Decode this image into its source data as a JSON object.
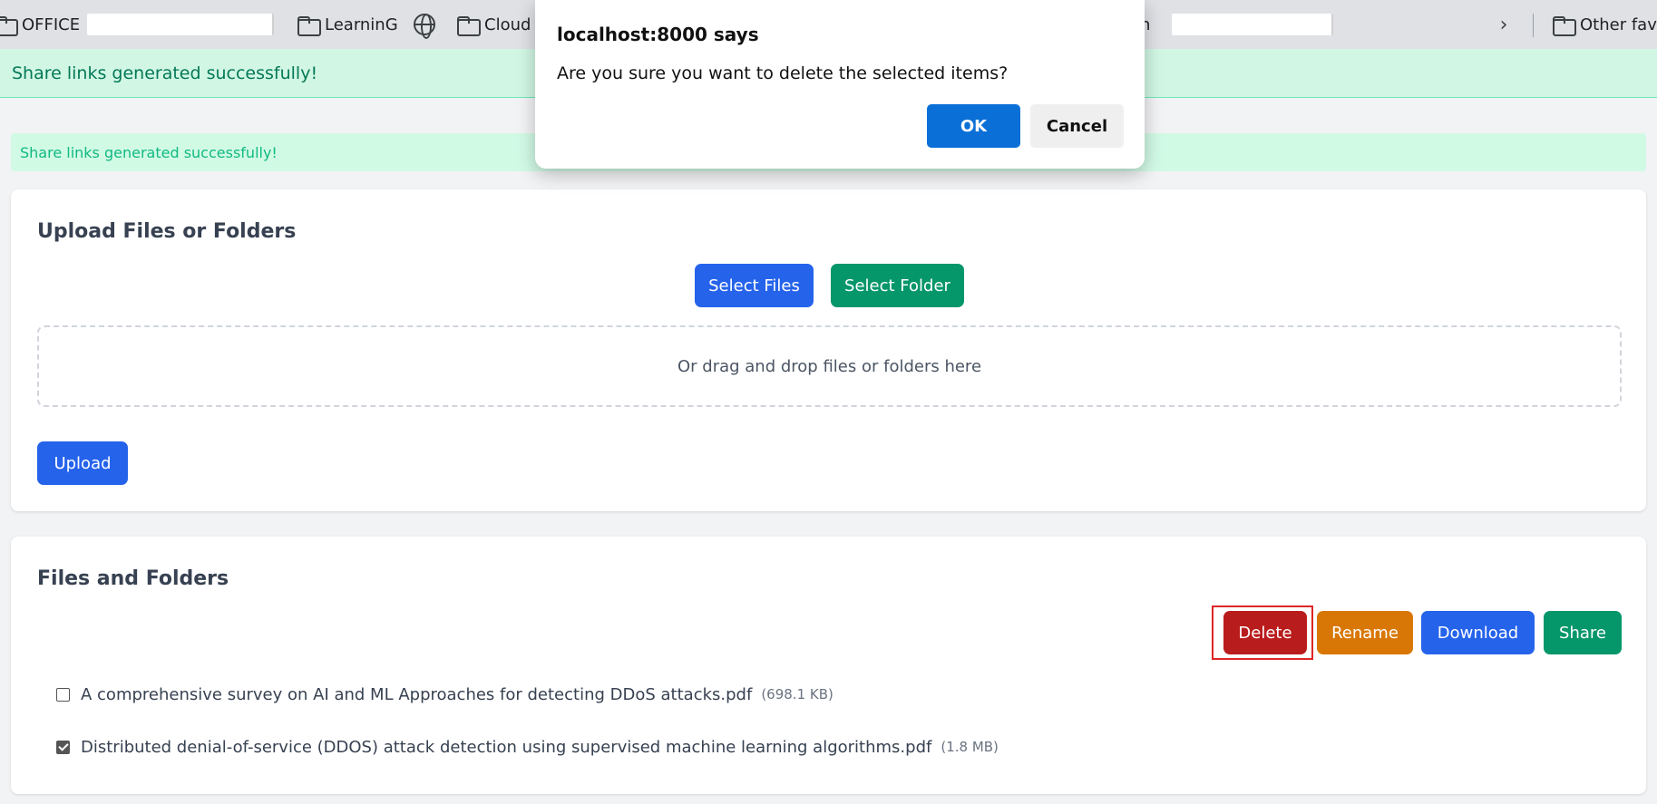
{
  "bookmarks": {
    "items": [
      {
        "label": "OFFICE",
        "icon": "folder-icon"
      },
      {
        "label": "",
        "icon": "blank"
      },
      {
        "label": "LearninG",
        "icon": "folder-icon"
      },
      {
        "label": "",
        "icon": "globe-icon"
      },
      {
        "label": "Cloud",
        "icon": "folder-icon"
      },
      {
        "label": "n",
        "icon": "none"
      },
      {
        "label": "",
        "icon": "blank"
      },
      {
        "label": "Other favo",
        "icon": "folder-icon"
      }
    ]
  },
  "banner": {
    "top_message": "Share links generated successfully!",
    "inner_message": "Share links generated successfully!"
  },
  "upload": {
    "title": "Upload Files or Folders",
    "select_files_label": "Select Files",
    "select_folder_label": "Select Folder",
    "dropzone_text": "Or drag and drop files or folders here",
    "upload_label": "Upload"
  },
  "files": {
    "title": "Files and Folders",
    "actions": {
      "delete": "Delete",
      "rename": "Rename",
      "download": "Download",
      "share": "Share"
    },
    "items": [
      {
        "name": "A comprehensive survey on AI and ML Approaches for detecting DDoS attacks.pdf",
        "size": "(698.1 KB)",
        "checked": false
      },
      {
        "name": "Distributed denial-of-service (DDOS) attack detection using supervised machine learning algorithms.pdf",
        "size": "(1.8 MB)",
        "checked": true
      }
    ]
  },
  "dialog": {
    "title": "localhost:8000 says",
    "message": "Are you sure you want to delete the selected items?",
    "ok_label": "OK",
    "cancel_label": "Cancel"
  },
  "colors": {
    "primary_blue": "#2563eb",
    "success_green": "#059669",
    "danger_red": "#b91c1c",
    "warning_orange": "#d97706",
    "dialog_blue": "#0a6fd6"
  }
}
